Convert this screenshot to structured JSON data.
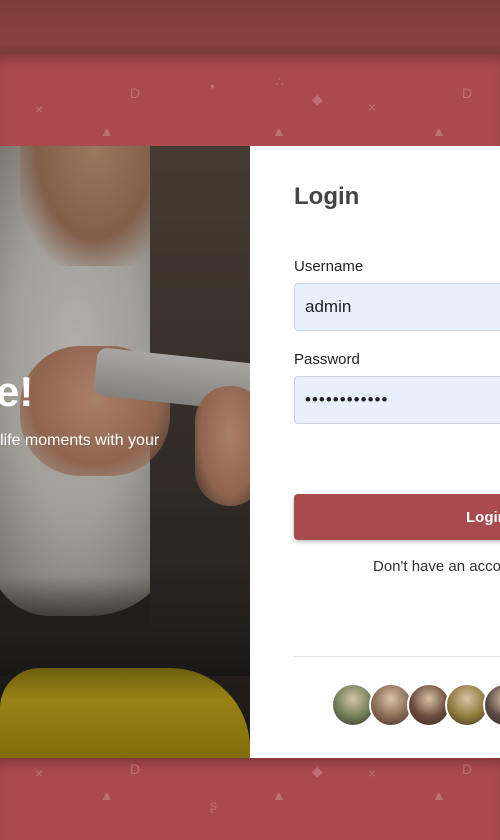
{
  "hero": {
    "title": "e!",
    "subtitle": "life moments with your"
  },
  "login": {
    "title": "Login",
    "username_label": "Username",
    "username_value": "admin",
    "password_label": "Password",
    "password_value": "••••••••••••",
    "button_label": "Login",
    "signup_text": "Don't have an acco"
  },
  "avatars": [
    {
      "name": "avatar-1",
      "color": "#6f7f58"
    },
    {
      "name": "avatar-2",
      "color": "#8a6a55"
    },
    {
      "name": "avatar-3",
      "color": "#6a4a3a"
    },
    {
      "name": "avatar-4",
      "color": "#8f7a3a"
    },
    {
      "name": "avatar-5",
      "color": "#5b4a44"
    }
  ],
  "colors": {
    "brand": "#a94a4c",
    "input_bg": "#e8f0fe"
  }
}
